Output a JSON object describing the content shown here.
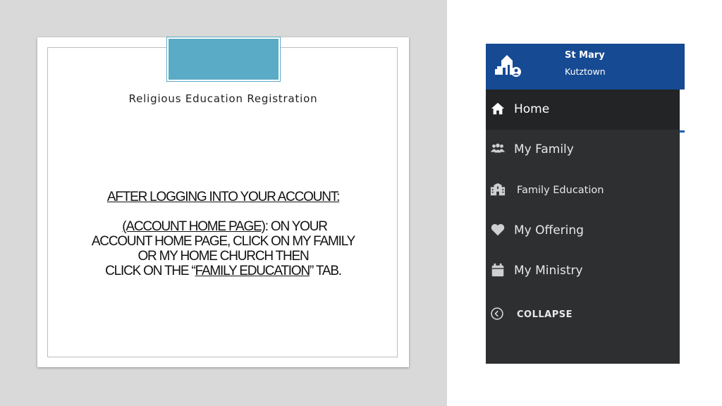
{
  "slide": {
    "title": "Religious Education Registration",
    "heading": "AFTER LOGGING INTO YOUR ACCOUNT:",
    "line1_link": "(ACCOUNT HOME PAGE)",
    "line1_rest": ":  ON YOUR",
    "line2": "ACCOUNT HOME PAGE,  CLICK ON MY FAMILY",
    "line3": "OR MY HOME CHURCH THEN",
    "line4_pre": "CLICK ON THE “",
    "line4_link": "FAMILY EDUCATION",
    "line4_post": "”  TAB."
  },
  "sidebar": {
    "parish_name": "St Mary",
    "parish_city": "Kutztown",
    "items": [
      {
        "label": "Home",
        "icon": "home-icon",
        "active": true
      },
      {
        "label": "My Family",
        "icon": "family-icon"
      },
      {
        "label": "Family Education",
        "icon": "school-icon"
      },
      {
        "label": "My Offering",
        "icon": "heart-icon"
      },
      {
        "label": "My Ministry",
        "icon": "calendar-icon"
      }
    ],
    "collapse_label": "COLLAPSE"
  },
  "colors": {
    "header_blue": "#164a93",
    "sidebar_bg": "#2d2f31",
    "accent_teal": "#5aabc5"
  }
}
